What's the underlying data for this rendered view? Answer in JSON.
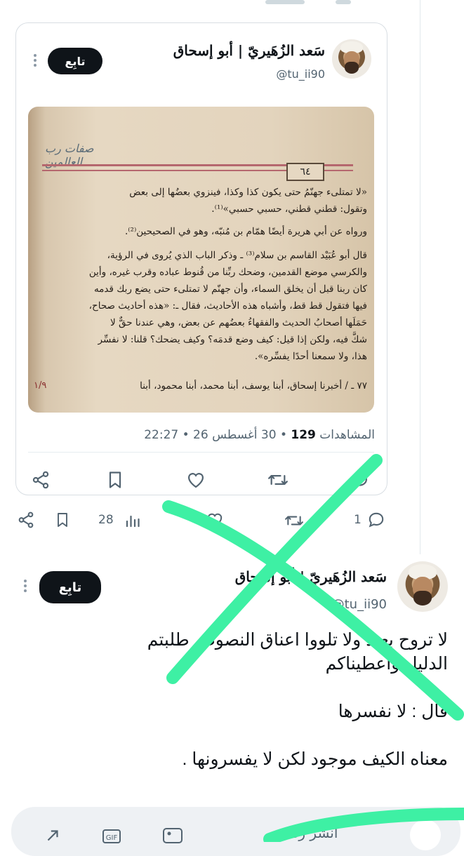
{
  "quoted_tweet": {
    "author_name": "سَعد الزُهَيريّ | أبو إسحاق",
    "handle": "@tu_ii90",
    "follow_label": "تابِع",
    "book_page": {
      "page_number": "٦٤",
      "header_ornament": "صفات رب العالمين",
      "lines": [
        "«لا تمتلىء جهنّمُ حتى يكون كذا وكذا، فينزوي بعضُها إلى بعض",
        "وتقول: قطني قطني، حسبي حسبي»⁽¹⁾.",
        "ورواه عن أبي هريرة أيضًا همّام بن مُنبّه، وهو في الصحيحين⁽²⁾.",
        "قال أبو عُبَيْد القاسم بن سلام⁽³⁾ ـ وذكر الباب الذي يُروى في الرؤية،",
        "والكرسي موضع القدمين، وضحك ربِّنا من قُنوط عباده وقرب غيره، وأين",
        "كان ربنا قبل أن يخلق السماء، وأن جهنّم لا تمتلىء حتى يضع ربك قدمه",
        "فيها فتقول قط قط، وأشباه هذه الأحاديث، فقال ـ: «هذه أحاديث صحاح،",
        "حَمَلَها أصحابُ الحديث والفقهاءُ بعضُهم عن بعض، وهي عندنا حقٌّ لا",
        "شكَّ فيه، ولكن إذا قيل: كيف وضع قدمَه؟ وكيف يضحك؟ قلنا: لا نفسِّر",
        "هذا، ولا سمعنا أحدًا يفسِّره».",
        "٧٧ ـ / أخبرنا إسحاق، أبنا يوسف، أبنا محمد، أبنا محمود، أبنا"
      ],
      "margin_number": "١/٩"
    },
    "meta": {
      "time": "22:27",
      "date": "30 أغسطس 26",
      "views_count": "129",
      "views_label": "المشاهدات"
    }
  },
  "outer_actions": {
    "views": "28",
    "replies": "1"
  },
  "reply_tweet": {
    "author_name": "سَعد الزُهَيريّ | أبو إسحاق",
    "handle": "@tu_ii90",
    "follow_label": "تابِع",
    "paragraphs": [
      "لا تروح بعيد ولا تلووا اعناق النصوص طلبتم الدليل واعطيناكم",
      "قال : لا نفسرها",
      "معناه الكيف موجود لكن لا يفسرونها ."
    ]
  },
  "reply_bar": {
    "placeholder": "انشر ردّك"
  },
  "colors": {
    "text": "#0f1419",
    "muted": "#536471",
    "border": "#d8dee3",
    "follow_bg": "#0f1419",
    "overlay_green": "#3ef0a4"
  },
  "icons": [
    "share-icon",
    "bookmark-icon",
    "like-icon",
    "retweet-icon",
    "reply-icon",
    "views-icon",
    "more-icon",
    "gif-icon",
    "image-icon"
  ]
}
